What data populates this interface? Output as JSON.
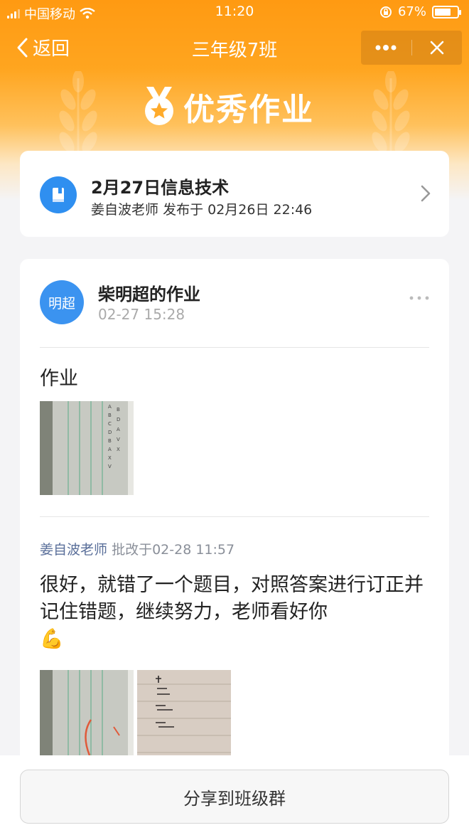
{
  "status_bar": {
    "carrier": "中国移动",
    "time": "11:20",
    "battery": "67%"
  },
  "nav": {
    "back_label": "返回",
    "title": "三年级7班"
  },
  "banner": {
    "title": "优秀作业"
  },
  "assignment": {
    "title": "2月27日信息技术",
    "teacher": "姜自波老师",
    "published_label": "发布于",
    "published_time": "02月26日 22:46"
  },
  "homework": {
    "avatar_text": "明超",
    "author": "柴明超的作业",
    "time": "02-27 15:28",
    "text": "作业",
    "reviewer": "姜自波老师",
    "review_label": "批改于",
    "review_time": "02-28 11:57",
    "comment": "很好，就错了一个题目，对照答案进行订正并记住错题，继续努力，老师看好你",
    "comment_emoji": "💪"
  },
  "share": {
    "label": "分享到班级群"
  },
  "colors": {
    "accent": "#ff9a12",
    "avatar_blue": "#3b93f0",
    "icon_blue": "#2f8ff0"
  },
  "icons": [
    "signal-icon",
    "wifi-icon",
    "lock-rotation-icon",
    "battery-icon",
    "back-chevron-icon",
    "more-dots-icon",
    "close-icon",
    "medal-icon",
    "book-icon",
    "chevron-right-icon",
    "ellipsis-icon",
    "muscle-emoji"
  ]
}
